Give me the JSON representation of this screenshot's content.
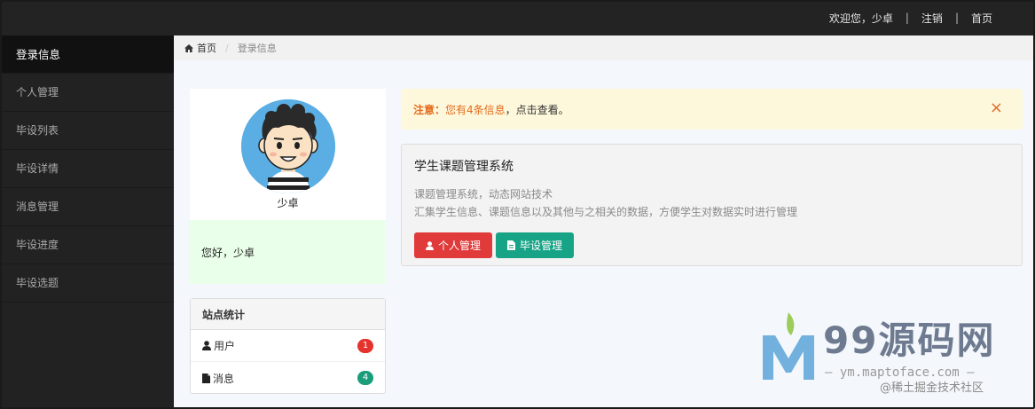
{
  "topbar": {
    "welcome": "欢迎您，少卓",
    "logout": "注销",
    "home": "首页"
  },
  "sidebar": {
    "items": [
      {
        "label": "登录信息"
      },
      {
        "label": "个人管理"
      },
      {
        "label": "毕设列表"
      },
      {
        "label": "毕设详情"
      },
      {
        "label": "消息管理"
      },
      {
        "label": "毕设进度"
      },
      {
        "label": "毕设选题"
      }
    ]
  },
  "breadcrumb": {
    "home": "首页",
    "current": "登录信息"
  },
  "profile": {
    "name": "少卓",
    "greeting": "您好，少卓"
  },
  "stats": {
    "title": "站点统计",
    "rows": [
      {
        "label": "用户",
        "count": "1",
        "icon": "user-icon",
        "badge_color": "#e5322d"
      },
      {
        "label": "消息",
        "count": "4",
        "icon": "file-icon",
        "badge_color": "#1a9d7a"
      }
    ]
  },
  "alert": {
    "label": "注意：",
    "message": "您有4条信息",
    "tail": "，点击查看。",
    "close": "×"
  },
  "panel": {
    "title": "学生课题管理系统",
    "line1": "课题管理系统，动态网站技术",
    "line2": "汇集学生信息、课题信息以及其他与之相关的数据，方便学生对数据实时进行管理",
    "btn_personal": "个人管理",
    "btn_thesis": "毕设管理"
  },
  "watermark": {
    "brand": "99源码网",
    "url": "— ym.maptoface.com —",
    "credit": "@稀土掘金技术社区"
  },
  "colors": {
    "topbar": "#232323",
    "sidebar": "#222222",
    "alert_text": "#e46a1b",
    "btn_red": "#e03a3a",
    "btn_green": "#17a386"
  }
}
